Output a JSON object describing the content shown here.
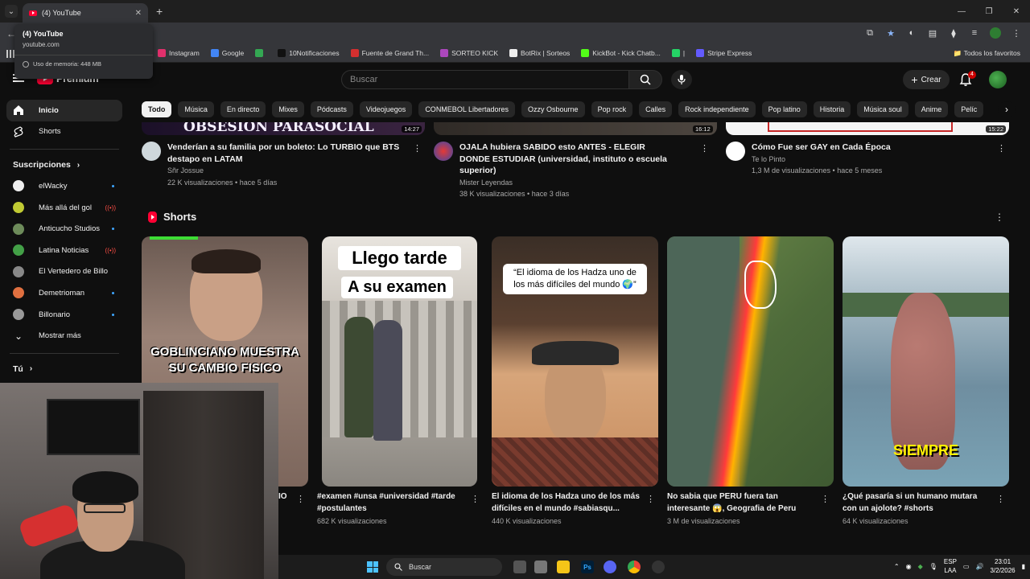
{
  "browser": {
    "tab_title": "(4) YouTube",
    "hover_card": {
      "title": "(4) YouTube",
      "url": "youtube.com",
      "memory": "Uso de memoria: 448 MB"
    },
    "bookmarks": [
      {
        "label": "Instagram",
        "color": "#e1306c"
      },
      {
        "label": "Google",
        "color": "#4285f4"
      },
      {
        "label": "",
        "color": "#34a853"
      },
      {
        "label": "10Notificaciones",
        "color": "#111111"
      },
      {
        "label": "Fuente de Grand Th...",
        "color": "#d32f2f"
      },
      {
        "label": "SORTEO KICK",
        "color": "#ab47bc"
      },
      {
        "label": "BotRix | Sorteos",
        "color": "#eeeeee"
      },
      {
        "label": "KickBot - Kick Chatb...",
        "color": "#53fc18"
      },
      {
        "label": "|",
        "color": "#25d366"
      },
      {
        "label": "Stripe Express",
        "color": "#635bff"
      }
    ],
    "bookmarks_right": "Todos los favoritos"
  },
  "header": {
    "logo_text": "Premium",
    "search_placeholder": "Buscar",
    "create_label": "Crear",
    "notif_count": "4"
  },
  "sidebar": {
    "main": [
      {
        "label": "Inicio",
        "icon": "home-icon",
        "active": true
      },
      {
        "label": "Shorts",
        "icon": "shorts-icon",
        "active": false
      }
    ],
    "subs_title": "Suscripciones",
    "channels": [
      {
        "name": "elWacky",
        "status": "dot",
        "color": "#eeeeee"
      },
      {
        "name": "Más allá del gol",
        "status": "live",
        "color": "#c0ca33"
      },
      {
        "name": "Anticucho Studios",
        "status": "dot",
        "color": "#6d8b5a"
      },
      {
        "name": "Latina Noticias",
        "status": "live",
        "color": "#43a047"
      },
      {
        "name": "El Vertedero de Billo",
        "status": "",
        "color": "#888888"
      },
      {
        "name": "Demetrioman",
        "status": "dot",
        "color": "#e07040"
      },
      {
        "name": "Billonario",
        "status": "dot",
        "color": "#999999"
      }
    ],
    "show_more": "Mostrar más",
    "you_title": "Tú"
  },
  "chips": [
    "Todo",
    "Música",
    "En directo",
    "Mixes",
    "Pódcasts",
    "Videojuegos",
    "CONMEBOL Libertadores",
    "Ozzy Osbourne",
    "Pop rock",
    "Calles",
    "Rock independiente",
    "Pop latino",
    "Historia",
    "Música soul",
    "Anime",
    "Pelíc"
  ],
  "videos": [
    {
      "title": "Venderían a su familia por un boleto: Lo TURBIO que BTS destapo en LATAM",
      "channel": "Sñr Jossue",
      "meta": "22 K visualizaciones • hace 5 días",
      "duration": "14:27",
      "thumb_text": "OBSESION PARASOCIAL",
      "avatar_color": "#cfd8dc"
    },
    {
      "title": "OJALA hubiera SABIDO esto ANTES - ELEGIR DONDE ESTUDIAR (universidad, instituto o escuela superior)",
      "channel": "Mister Leyendas",
      "meta": "38 K visualizaciones • hace 3 días",
      "duration": "16:12",
      "avatar_color": "#5c6bc0"
    },
    {
      "title": "Cómo Fue ser GAY en Cada Época",
      "channel": "Te lo Pinto",
      "meta": "1,3 M de visualizaciones • hace 5 meses",
      "duration": "15:22",
      "avatar_color": "#ffffff"
    }
  ],
  "shorts": {
    "title": "Shorts",
    "items": [
      {
        "caption": "IO",
        "views": "",
        "overlay": "GOBLINCIANO MUESTRA SU CAMBIO FISICO"
      },
      {
        "caption": "#examen #unsa #universidad #tarde #postulantes",
        "views": "682 K visualizaciones",
        "overlay_top": "Llego tarde",
        "overlay_bottom": "A su examen"
      },
      {
        "caption": "El idioma de los Hadza uno de los más difíciles en el mundo #sabiasqu...",
        "views": "440 K visualizaciones",
        "overlay": "“El idioma de los Hadza uno de los más difíciles del mundo 🌍”"
      },
      {
        "caption": "No sabia que PERU fuera tan interesante 😱, Geografia de Peru",
        "views": "3 M de visualizaciones"
      },
      {
        "caption": "¿Qué pasaría si un humano mutara con un ajolote? #shorts",
        "views": "64 K visualizaciones",
        "overlay": "SIEMPRE"
      }
    ]
  },
  "taskbar": {
    "search": "Buscar",
    "lang_top": "ESP",
    "lang_bottom": "LAA",
    "time": "23:01",
    "date": "3/2/2026"
  }
}
